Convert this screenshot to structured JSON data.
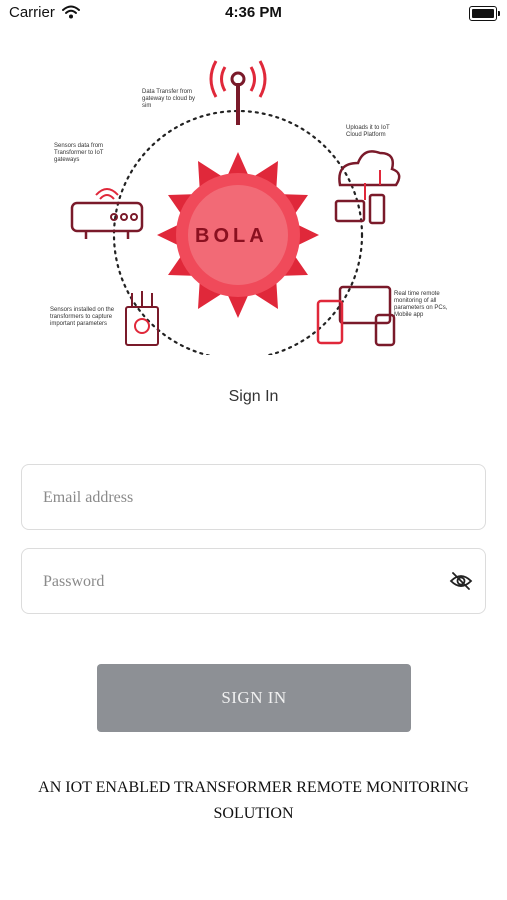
{
  "status_bar": {
    "carrier": "Carrier",
    "time": "4:36 PM"
  },
  "hero": {
    "logo_text": "BOLA",
    "label_data_transfer": "Data Transfer from gateway to cloud by sim",
    "label_sensors_data": "Sensors data from Transformer to IoT gateways",
    "label_uploads": "Uploads it to IoT Cloud Platform",
    "label_sensors_installed": "Sensors installed on the transformers to capture important parameters",
    "label_realtime": "Real time remote monitoring of all parameters on PCs, Mobile app",
    "accent_color": "#e0283a"
  },
  "signin": {
    "title": "Sign In",
    "email_placeholder": "Email address",
    "password_placeholder": "Password",
    "button_label": "SIGN IN"
  },
  "footer": {
    "tagline_line1": "AN IOT ENABLED TRANSFORMER REMOTE MONITORING",
    "tagline_line2": "SOLUTION"
  }
}
